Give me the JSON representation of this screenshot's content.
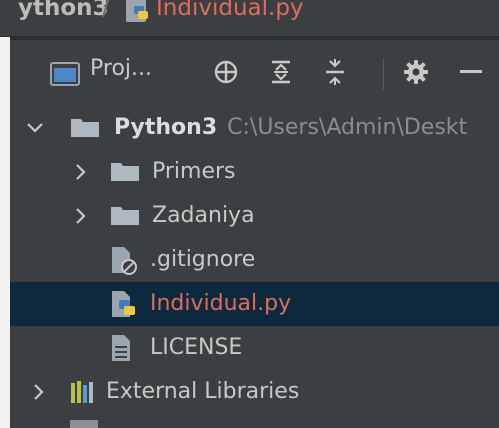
{
  "navbar": {
    "project": "ython3",
    "separator": "/",
    "file": "Individual.py"
  },
  "tool_window": {
    "label": "Proj...",
    "icons": [
      "project-view-icon",
      "locate-icon",
      "expand-all-icon",
      "collapse-all-icon",
      "gear-icon",
      "minimize-icon"
    ]
  },
  "tree": {
    "root": {
      "name": "Python3",
      "path": "C:\\Users\\Admin\\Deskt"
    },
    "items": [
      {
        "label": "Primers"
      },
      {
        "label": "Zadaniya"
      },
      {
        "label": ".gitignore"
      },
      {
        "label": "Individual.py"
      },
      {
        "label": "LICENSE"
      },
      {
        "label": "External Libraries"
      }
    ]
  },
  "colors": {
    "background": "#3c3f41",
    "selection": "#0d293e",
    "modified_file": "#e06c5a",
    "text": "#c8c8c8",
    "folder": "#aeb9c0"
  }
}
